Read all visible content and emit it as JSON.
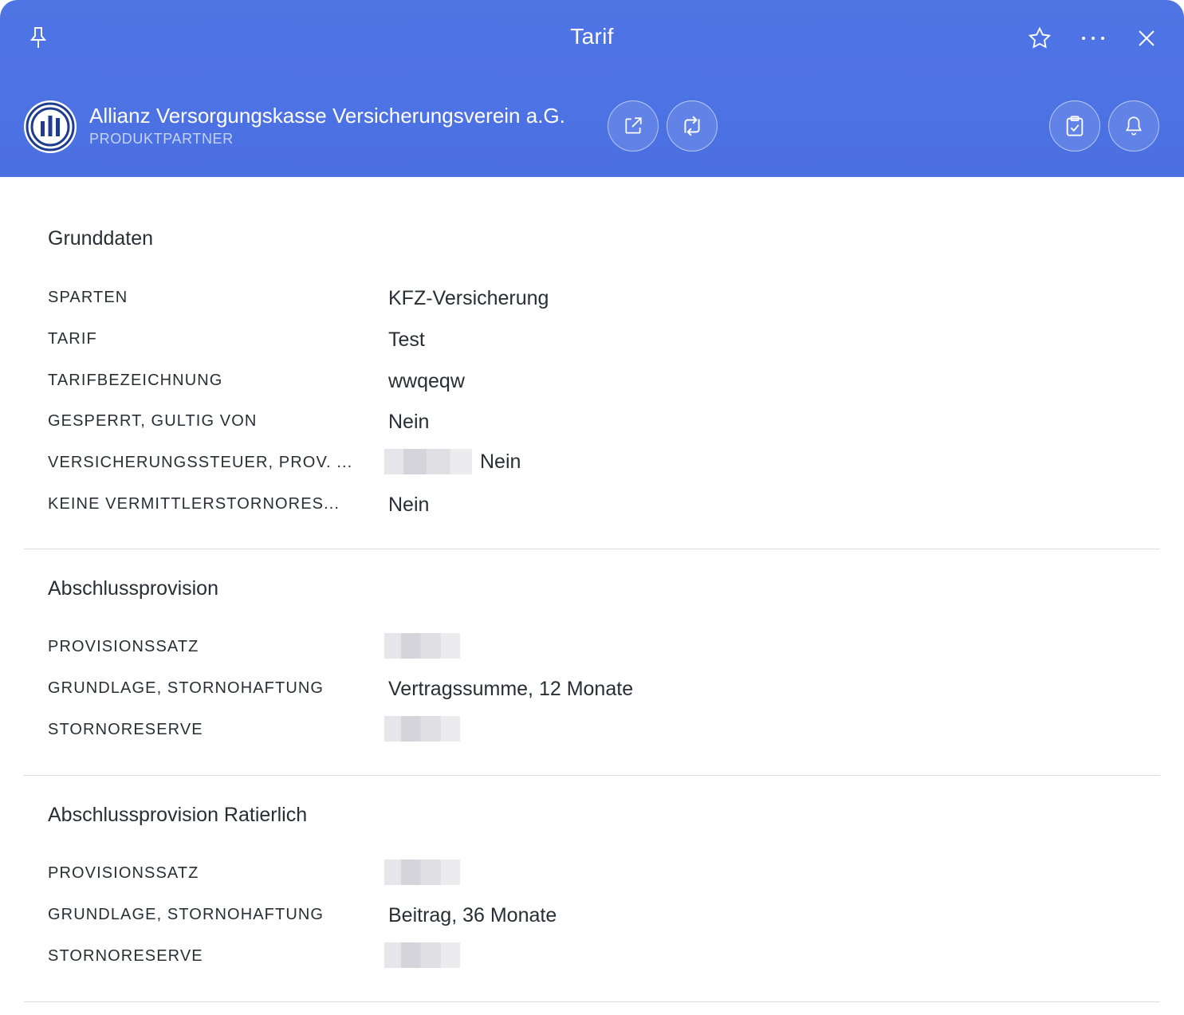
{
  "window": {
    "title": "Tarif"
  },
  "partner": {
    "name": "Allianz Versorgungskasse Versicherungsverein a.G.",
    "type": "PRODUKTPARTNER"
  },
  "header_icons": {
    "pin": "pin-icon",
    "star": "star-icon",
    "more": "more-icon",
    "close": "close-icon",
    "external": "external-link-icon",
    "swap": "swap-icon",
    "clipboard": "clipboard-check-icon",
    "bell": "bell-icon"
  },
  "colors": {
    "header": "#4b70e2",
    "logo_blue": "#1f3d8f"
  },
  "sections": [
    {
      "title": "Grunddaten",
      "rows": [
        {
          "label": "SPARTEN",
          "value": "KFZ-Versicherung"
        },
        {
          "label": "TARIF",
          "value": "Test"
        },
        {
          "label": "TARIFBEZEICHNUNG",
          "value": "wwqeqw"
        },
        {
          "label": "GESPERRT, GULTIG VON",
          "value": "Nein"
        },
        {
          "label": "VERSICHERUNGSSTEUER, PROV. ...",
          "value": "Nein"
        },
        {
          "label": "KEINE VERMITTLERSTORNORES...",
          "value": "Nein"
        }
      ]
    },
    {
      "title": "Abschlussprovision",
      "rows": [
        {
          "label": "PROVISIONSSATZ",
          "value": ""
        },
        {
          "label": "GRUNDLAGE, STORNOHAFTUNG",
          "value": "Vertragssumme, 12 Monate"
        },
        {
          "label": "STORNORESERVE",
          "value": ""
        }
      ]
    },
    {
      "title": "Abschlussprovision Ratierlich",
      "rows": [
        {
          "label": "PROVISIONSSATZ",
          "value": ""
        },
        {
          "label": "GRUNDLAGE, STORNOHAFTUNG",
          "value": "Beitrag, 36 Monate"
        },
        {
          "label": "STORNORESERVE",
          "value": ""
        }
      ]
    }
  ]
}
